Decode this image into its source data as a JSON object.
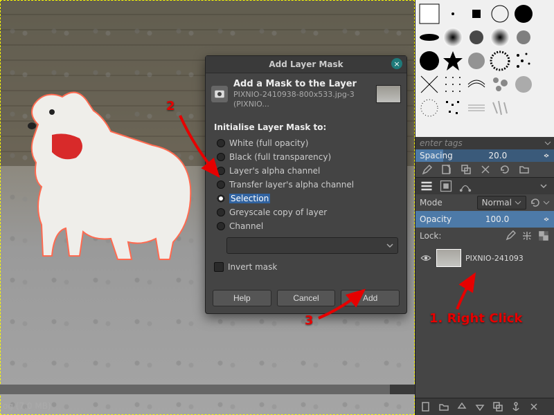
{
  "canvas": {
    "status": "og (7.0 MB)"
  },
  "dialog": {
    "title": "Add Layer Mask",
    "header": "Add a Mask to the Layer",
    "subheader": "PIXNIO-2410938-800x533.jpg-3 (PIXNIO...",
    "section": "Initialise Layer Mask to:",
    "options": {
      "white": "White (full opacity)",
      "black": "Black (full transparency)",
      "alpha": "Layer's alpha channel",
      "transfer": "Transfer layer's alpha channel",
      "selection": "Selection",
      "greyscale": "Greyscale copy of layer",
      "channel": "Channel"
    },
    "invert": "Invert mask",
    "buttons": {
      "help": "Help",
      "cancel": "Cancel",
      "add": "Add"
    }
  },
  "dock": {
    "tags_placeholder": "enter tags",
    "spacing_label": "Spacing",
    "spacing_value": "20.0",
    "mode_label": "Mode",
    "mode_value": "Normal",
    "opacity_label": "Opacity",
    "opacity_value": "100.0",
    "lock_label": "Lock:",
    "layer_name": "PIXNIO-241093"
  },
  "annotations": {
    "step1": "1. Right Click",
    "step2": "2",
    "step3": "3"
  }
}
